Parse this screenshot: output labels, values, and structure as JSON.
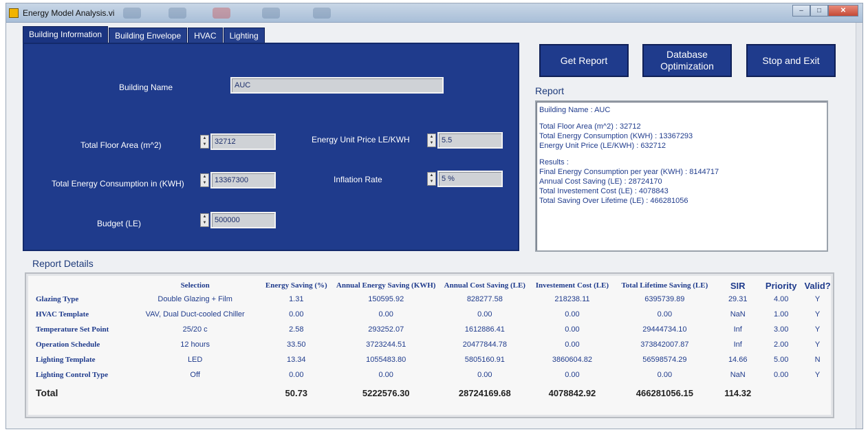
{
  "window": {
    "title": "Energy Model Analysis.vi",
    "buttons": [
      "–",
      "□",
      "✕"
    ]
  },
  "tabs": [
    "Building Information",
    "Building Envelope",
    "HVAC",
    "Lighting"
  ],
  "building": {
    "name_label": "Building Name",
    "name_value": "AUC",
    "floor_area_label": "Total Floor Area (m^2)",
    "floor_area_value": "32712",
    "energy_label": "Total Energy Consumption in (KWH)",
    "energy_value": "13367300",
    "budget_label": "Budget (LE)",
    "budget_value": "500000",
    "price_label": "Energy Unit Price LE/KWH",
    "price_value": "5.5",
    "inflation_label": "Inflation Rate",
    "inflation_value": "5 %"
  },
  "actions": {
    "get_report": "Get Report",
    "db_opt": "Database Optimization",
    "stop_exit": "Stop and Exit"
  },
  "report": {
    "label": "Report",
    "lines": [
      "Building Name : AUC",
      "",
      "Total Floor Area (m^2) : 32712",
      "Total Energy Consumption (KWH) : 13367293",
      "Energy Unit Price (LE/KWH) : 632712",
      "",
      "Results :",
      "Final Energy Consumption per year (KWH) : 8144717",
      "Annual Cost Saving (LE) : 28724170",
      "Total Investement Cost (LE) : 4078843",
      "Total Saving Over Lifetime (LE) : 466281056"
    ]
  },
  "details": {
    "label": "Report Details",
    "headers": [
      "",
      "Selection",
      "Energy Saving (%)",
      "Annual Energy Saving (KWH)",
      "Annual Cost Saving (LE)",
      "Investement Cost (LE)",
      "Total Lifetime Saving (LE)",
      "SIR",
      "Priority",
      "Valid?"
    ],
    "rows": [
      [
        "Glazing Type",
        "Double Glazing + Film",
        "1.31",
        "150595.92",
        "828277.58",
        "218238.11",
        "6395739.89",
        "29.31",
        "4.00",
        "Y"
      ],
      [
        "HVAC Template",
        "VAV, Dual Duct-cooled Chiller",
        "0.00",
        "0.00",
        "0.00",
        "0.00",
        "0.00",
        "NaN",
        "1.00",
        "Y"
      ],
      [
        "Temperature Set Point",
        "25/20 c",
        "2.58",
        "293252.07",
        "1612886.41",
        "0.00",
        "29444734.10",
        "Inf",
        "3.00",
        "Y"
      ],
      [
        "Operation Schedule",
        "12 hours",
        "33.50",
        "3723244.51",
        "20477844.78",
        "0.00",
        "373842007.87",
        "Inf",
        "2.00",
        "Y"
      ],
      [
        "Lighting Template",
        "LED",
        "13.34",
        "1055483.80",
        "5805160.91",
        "3860604.82",
        "56598574.29",
        "14.66",
        "5.00",
        "N"
      ],
      [
        "Lighting Control Type",
        "Off",
        "0.00",
        "0.00",
        "0.00",
        "0.00",
        "0.00",
        "NaN",
        "0.00",
        "Y"
      ]
    ],
    "total": [
      "Total",
      "",
      "50.73",
      "5222576.30",
      "28724169.68",
      "4078842.92",
      "466281056.15",
      "114.32",
      "",
      ""
    ]
  }
}
